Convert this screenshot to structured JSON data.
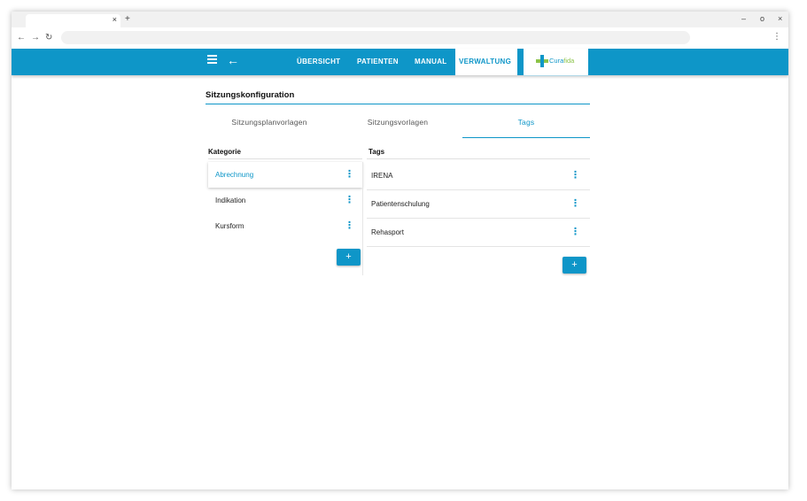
{
  "browser": {
    "tab_close": "×",
    "new_tab": "+",
    "minimize": "–",
    "maximize": "o",
    "close": "×",
    "back": "←",
    "forward": "→",
    "reload": "↻",
    "menu": "⋮"
  },
  "header": {
    "back_glyph": "←",
    "nav": [
      "ÜBERSICHT",
      "PATIENTEN",
      "MANUAL",
      "VERWALTUNG"
    ],
    "active_nav": "VERWALTUNG",
    "logo": {
      "part1": "Cura",
      "part2": "fida"
    },
    "colors": {
      "primary": "#0e96c8",
      "logo_green": "#8bc34a"
    }
  },
  "page": {
    "title": "Sitzungskonfiguration",
    "tabs": [
      "Sitzungsplanvorlagen",
      "Sitzungsvorlagen",
      "Tags"
    ],
    "active_tab": "Tags"
  },
  "kategorie": {
    "header": "Kategorie",
    "items": [
      "Abrechnung",
      "Indikation",
      "Kursform"
    ],
    "selected": "Abrechnung",
    "add_label": "+"
  },
  "tags": {
    "header": "Tags",
    "items": [
      "IRENA",
      "Patientenschulung",
      "Rehasport"
    ],
    "add_label": "+"
  },
  "icons": {
    "more": "⋮"
  }
}
